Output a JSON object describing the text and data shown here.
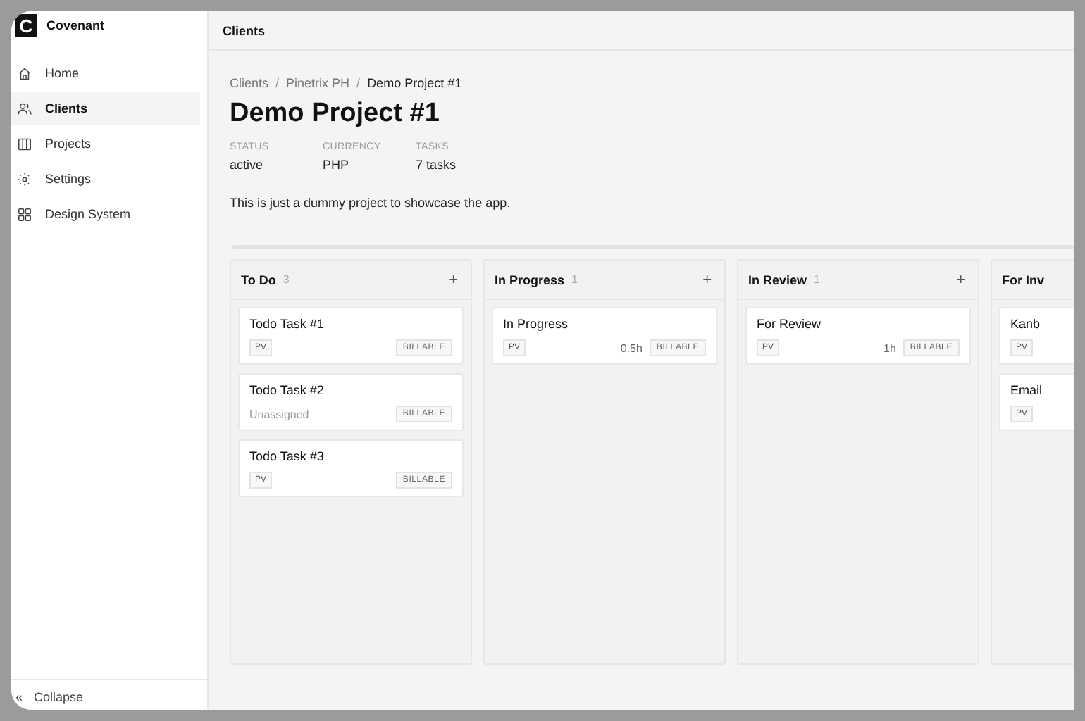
{
  "app": {
    "name": "Covenant",
    "logo": "C"
  },
  "sidebar": {
    "items": [
      {
        "label": "Home",
        "selected": false
      },
      {
        "label": "Clients",
        "selected": true
      },
      {
        "label": "Projects",
        "selected": false
      },
      {
        "label": "Settings",
        "selected": false
      },
      {
        "label": "Design System",
        "selected": false
      }
    ],
    "collapse": {
      "icon": "«",
      "label": "Collapse"
    }
  },
  "header": {
    "title": "Clients"
  },
  "breadcrumbs": [
    "Clients",
    "Pinetrix PH",
    "Demo Project #1"
  ],
  "breadcrumb_separator": "/",
  "project": {
    "title": "Demo Project #1",
    "description": "This is just a dummy project to showcase the app.",
    "meta": [
      {
        "label": "STATUS",
        "value": "active"
      },
      {
        "label": "CURRENCY",
        "value": "PHP"
      },
      {
        "label": "TASKS",
        "value": "7 tasks"
      }
    ]
  },
  "board": {
    "columns": [
      {
        "title": "To Do",
        "count": "3",
        "add": "+",
        "cards": [
          {
            "title": "Todo Task #1",
            "assignee": "PV",
            "kind": "assigned",
            "tag": "BILLABLE"
          },
          {
            "title": "Todo Task #2",
            "assignee": "Unassigned",
            "kind": "unassigned",
            "tag": "BILLABLE"
          },
          {
            "title": "Todo Task #3",
            "assignee": "PV",
            "kind": "assigned",
            "tag": "BILLABLE"
          }
        ]
      },
      {
        "title": "In Progress",
        "count": "1",
        "add": "+",
        "cards": [
          {
            "title": "In Progress",
            "assignee": "PV",
            "kind": "assigned",
            "hours": "0.5h",
            "tag": "BILLABLE"
          }
        ]
      },
      {
        "title": "In Review",
        "count": "1",
        "add": "+",
        "cards": [
          {
            "title": "For Review",
            "assignee": "PV",
            "kind": "assigned",
            "hours": "1h",
            "tag": "BILLABLE"
          }
        ]
      },
      {
        "title": "For Inv",
        "cards": [
          {
            "title": "Kanb",
            "assignee": "PV",
            "kind": "assigned"
          },
          {
            "title": "Email",
            "assignee": "PV",
            "kind": "assigned"
          }
        ]
      }
    ]
  }
}
